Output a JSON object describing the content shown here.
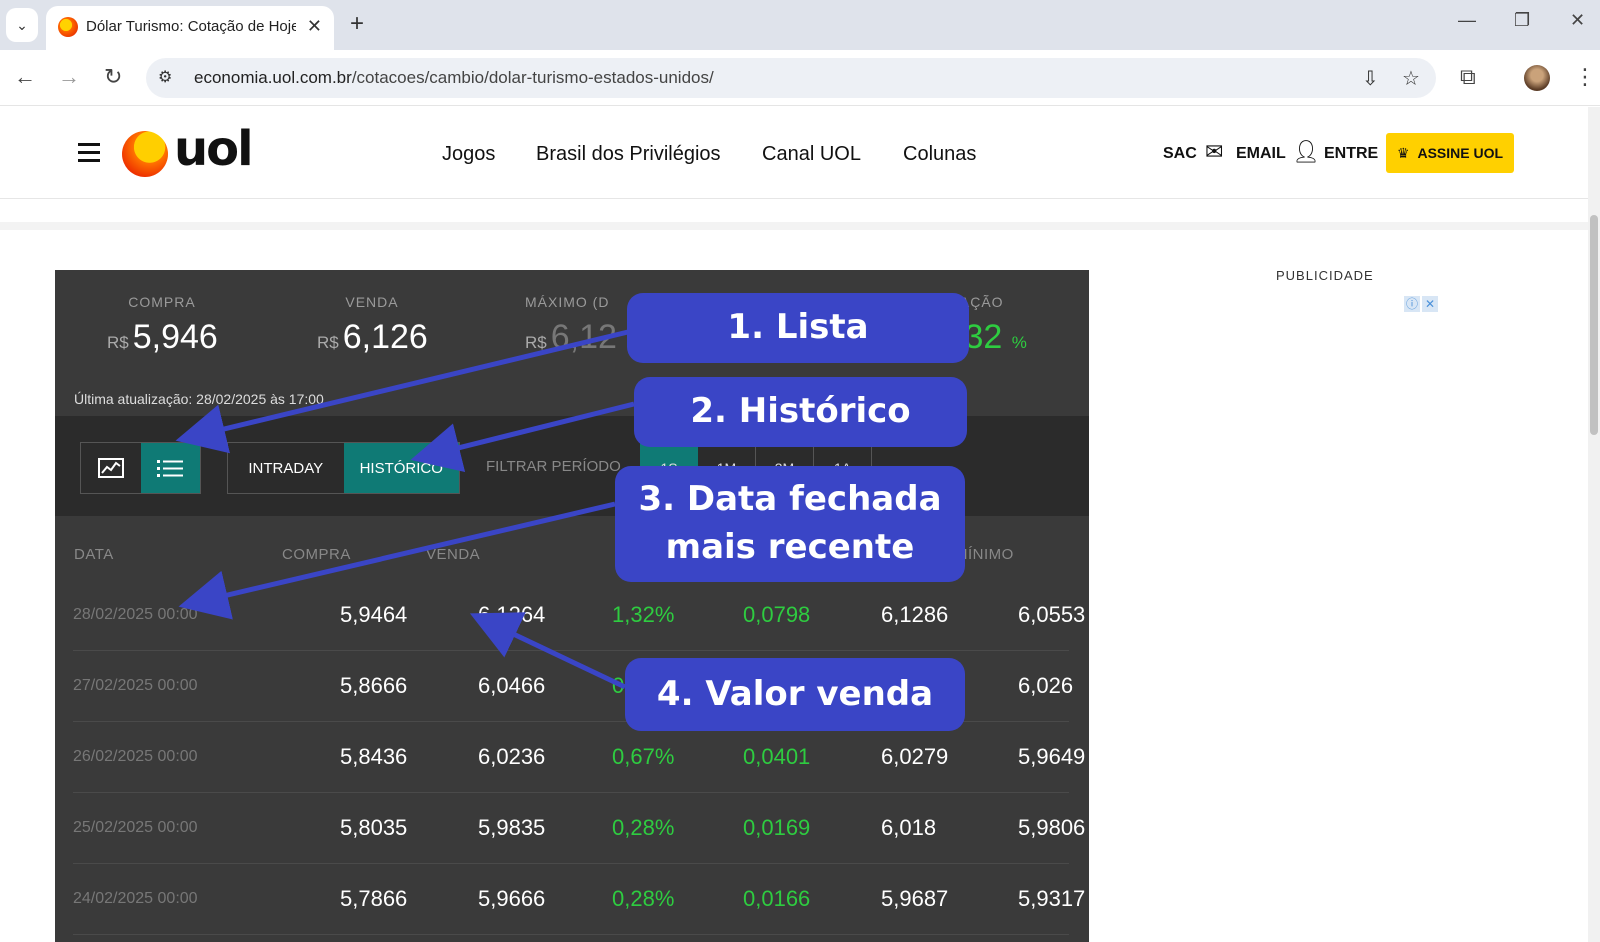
{
  "browser": {
    "tab_title": "Dólar Turismo: Cotação de Hoje",
    "url_host": "economia.uol.com.br",
    "url_path": "/cotacoes/cambio/dolar-turismo-estados-unidos/"
  },
  "header": {
    "logo_text": "uol",
    "menu": [
      "Jogos",
      "Brasil dos Privilégios",
      "Canal UOL",
      "Colunas"
    ],
    "sac": "SAC",
    "email": "EMAIL",
    "entre": "ENTRE",
    "assine": "ASSINE UOL"
  },
  "ad": {
    "label": "PUBLICIDADE"
  },
  "quote": {
    "currency_prefix": "R$",
    "stats": [
      {
        "label": "COMPRA",
        "value": "5,946"
      },
      {
        "label": "VENDA",
        "value": "6,126"
      },
      {
        "label": "MÁXIMO (D",
        "value": "6,12"
      },
      {
        "label": "IAÇÃO",
        "value": ",32",
        "unit": "%"
      }
    ],
    "updated": "Última atualização: 28/02/2025 às 17:00",
    "range_buttons": [
      "INTRADAY",
      "HISTÓRICO"
    ],
    "filter_label": "FILTRAR PERÍODO",
    "periods": [
      "1S",
      "1M",
      "3M",
      "1A"
    ],
    "table": {
      "headers": [
        "DATA",
        "COMPRA",
        "VENDA",
        "MÍNIMO"
      ],
      "rows": [
        [
          "28/02/2025 00:00",
          "5,9464",
          "6,1264",
          "1,32%",
          "0,0798",
          "6,1286",
          "6,0553"
        ],
        [
          "27/02/2025 00:00",
          "5,8666",
          "6,0466",
          "0,38%",
          "",
          "",
          "6,026"
        ],
        [
          "26/02/2025 00:00",
          "5,8436",
          "6,0236",
          "0,67%",
          "0,0401",
          "6,0279",
          "5,9649"
        ],
        [
          "25/02/2025 00:00",
          "5,8035",
          "5,9835",
          "0,28%",
          "0,0169",
          "6,018",
          "5,9806"
        ],
        [
          "24/02/2025 00:00",
          "5,7866",
          "5,9666",
          "0,28%",
          "0,0166",
          "5,9687",
          "5,9317"
        ]
      ]
    }
  },
  "annotations": {
    "c1": "1. Lista",
    "c2": "2. Histórico",
    "c3a": "3. Data fechada",
    "c3b": "mais recente",
    "c4": "4. Valor venda"
  },
  "colors": {
    "accent_teal": "#0f7a75",
    "annotation_blue": "#3a45c6",
    "positive_green": "#2ecc40",
    "brand_yellow": "#ffd000"
  }
}
